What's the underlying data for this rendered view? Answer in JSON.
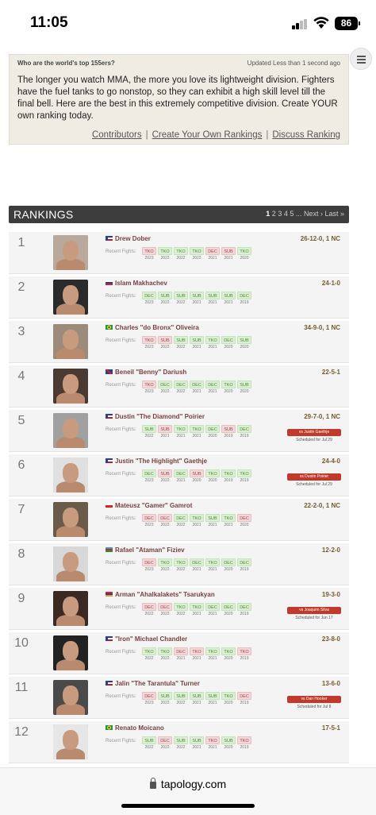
{
  "status_bar": {
    "time": "11:05",
    "battery": "86"
  },
  "intro": {
    "question": "Who are the world's top 155ers?",
    "updated": "Updated Less than 1 second ago",
    "text": "The longer you watch MMA, the more you love its lightweight division. Fighters have the fuel tanks to go nonstop, so they can exhibit a high skill level till the final bell. Here are the best in this extremely competitive division. Create YOUR own ranking today.",
    "links": [
      "Contributors",
      "Create Your Own Rankings",
      "Discuss Ranking"
    ]
  },
  "rankings": {
    "title": "RANKINGS",
    "pages": [
      "1",
      "2",
      "3",
      "4",
      "5"
    ],
    "pager_ellipsis": "...",
    "next": "Next ›",
    "last": "Last »"
  },
  "recent_label": "Recent Fights:",
  "colors": {
    "win": "#4a8a3a",
    "loss": "#a44",
    "accent": "#c0392b"
  },
  "fighters": [
    {
      "rank": "1",
      "flag": "us-flag",
      "name": "Drew Dober",
      "record": "26-12-0, 1 NC",
      "fights": [
        [
          "TKO",
          "L",
          "2023"
        ],
        [
          "TKO",
          "W",
          "2022"
        ],
        [
          "TKO",
          "W",
          "2022"
        ],
        [
          "TKO",
          "W",
          "2022"
        ],
        [
          "DEC",
          "L",
          "2021"
        ],
        [
          "SUB",
          "L",
          "2021"
        ],
        [
          "TKO",
          "W",
          "2020"
        ]
      ]
    },
    {
      "rank": "2",
      "flag": "ru-flag",
      "name": "Islam Makhachev",
      "record": "24-1-0",
      "fights": [
        [
          "DEC",
          "W",
          "2023"
        ],
        [
          "SUB",
          "W",
          "2022"
        ],
        [
          "SUB",
          "W",
          "2022"
        ],
        [
          "SUB",
          "W",
          "2021"
        ],
        [
          "SUB",
          "W",
          "2021"
        ],
        [
          "SUB",
          "W",
          "2021"
        ],
        [
          "DEC",
          "W",
          "2019"
        ]
      ]
    },
    {
      "rank": "3",
      "flag": "br-flag",
      "name": "Charles \"do Bronx\" Oliveira",
      "record": "34-9-0, 1 NC",
      "fights": [
        [
          "TKO",
          "L",
          "2023"
        ],
        [
          "SUB",
          "L",
          "2022"
        ],
        [
          "SUB",
          "W",
          "2022"
        ],
        [
          "SUB",
          "W",
          "2021"
        ],
        [
          "TKO",
          "W",
          "2021"
        ],
        [
          "DEC",
          "W",
          "2020"
        ],
        [
          "SUB",
          "W",
          "2020"
        ]
      ]
    },
    {
      "rank": "4",
      "flag": "gb-flag",
      "name": "Beneil \"Benny\" Dariush",
      "record": "22-5-1",
      "fights": [
        [
          "TKO",
          "L",
          "2023"
        ],
        [
          "DEC",
          "W",
          "2022"
        ],
        [
          "DEC",
          "W",
          "2022"
        ],
        [
          "DEC",
          "W",
          "2021"
        ],
        [
          "DEC",
          "W",
          "2021"
        ],
        [
          "TKO",
          "W",
          "2020"
        ],
        [
          "SUB",
          "W",
          "2020"
        ]
      ]
    },
    {
      "rank": "5",
      "flag": "us-flag",
      "name": "Dustin \"The Diamond\" Poirier",
      "record": "29-7-0, 1 NC",
      "fights": [
        [
          "SUB",
          "W",
          "2022"
        ],
        [
          "SUB",
          "L",
          "2021"
        ],
        [
          "TKO",
          "W",
          "2021"
        ],
        [
          "TKO",
          "W",
          "2021"
        ],
        [
          "DEC",
          "W",
          "2020"
        ],
        [
          "SUB",
          "L",
          "2019"
        ],
        [
          "DEC",
          "W",
          "2019"
        ]
      ],
      "next": {
        "label": "vs Justin Gaethje",
        "scheduled": "Scheduled for Jul 29"
      }
    },
    {
      "rank": "6",
      "flag": "us-flag",
      "name": "Justin \"The Highlight\" Gaethje",
      "record": "24-4-0",
      "fights": [
        [
          "DEC",
          "W",
          "2023"
        ],
        [
          "SUB",
          "L",
          "2022"
        ],
        [
          "DEC",
          "W",
          "2021"
        ],
        [
          "SUB",
          "L",
          "2020"
        ],
        [
          "TKO",
          "W",
          "2020"
        ],
        [
          "TKO",
          "W",
          "2019"
        ],
        [
          "TKO",
          "W",
          "2019"
        ]
      ],
      "next": {
        "label": "vs Dustin Poirier",
        "scheduled": "Scheduled for Jul 29"
      }
    },
    {
      "rank": "7",
      "flag": "pl-flag",
      "name": "Mateusz \"Gamer\" Gamrot",
      "record": "22-2-0, 1 NC",
      "fights": [
        [
          "DEC",
          "L",
          "2023"
        ],
        [
          "DEC",
          "L",
          "2022"
        ],
        [
          "DEC",
          "W",
          "2022"
        ],
        [
          "TKO",
          "W",
          "2021"
        ],
        [
          "SUB",
          "W",
          "2021"
        ],
        [
          "TKO",
          "W",
          "2021"
        ],
        [
          "DEC",
          "L",
          "2020"
        ]
      ]
    },
    {
      "rank": "8",
      "flag": "az-flag",
      "name": "Rafael \"Ataman\" Fiziev",
      "record": "12-2-0",
      "fights": [
        [
          "DEC",
          "L",
          "2023"
        ],
        [
          "TKO",
          "W",
          "2022"
        ],
        [
          "TKO",
          "W",
          "2022"
        ],
        [
          "DEC",
          "W",
          "2021"
        ],
        [
          "TKO",
          "W",
          "2021"
        ],
        [
          "DEC",
          "W",
          "2020"
        ],
        [
          "DEC",
          "W",
          "2019"
        ]
      ]
    },
    {
      "rank": "9",
      "flag": "am-flag",
      "name": "Arman \"Ahalkalakets\" Tsarukyan",
      "record": "19-3-0",
      "fights": [
        [
          "DEC",
          "L",
          "2022"
        ],
        [
          "DEC",
          "L",
          "2022"
        ],
        [
          "TKO",
          "W",
          "2022"
        ],
        [
          "TKO",
          "W",
          "2021"
        ],
        [
          "DEC",
          "W",
          "2021"
        ],
        [
          "DEC",
          "W",
          "2020"
        ],
        [
          "DEC",
          "W",
          "2019"
        ]
      ],
      "next": {
        "label": "vs Joaquim Silva",
        "scheduled": "Scheduled for Jun 17"
      }
    },
    {
      "rank": "10",
      "flag": "us-flag",
      "name": "\"Iron\" Michael Chandler",
      "record": "23-8-0",
      "fights": [
        [
          "TKO",
          "W",
          "2022"
        ],
        [
          "TKO",
          "W",
          "2022"
        ],
        [
          "DEC",
          "L",
          "2021"
        ],
        [
          "TKO",
          "L",
          "2021"
        ],
        [
          "TKO",
          "W",
          "2021"
        ],
        [
          "TKO",
          "W",
          "2020"
        ],
        [
          "TKO",
          "L",
          "2019"
        ]
      ]
    },
    {
      "rank": "11",
      "flag": "us-flag",
      "name": "Jalin \"The Tarantula\" Turner",
      "record": "13-6-0",
      "fights": [
        [
          "DEC",
          "L",
          "2023"
        ],
        [
          "SUB",
          "W",
          "2022"
        ],
        [
          "SUB",
          "W",
          "2022"
        ],
        [
          "SUB",
          "W",
          "2021"
        ],
        [
          "SUB",
          "W",
          "2021"
        ],
        [
          "TKO",
          "W",
          "2020"
        ],
        [
          "DEC",
          "L",
          "2019"
        ]
      ],
      "next": {
        "label": "vs Dan Hooker",
        "scheduled": "Scheduled for Jul 8"
      }
    },
    {
      "rank": "12",
      "flag": "br-flag",
      "name": "Renato Moicano",
      "record": "17-5-1",
      "fights": [
        [
          "SUB",
          "W",
          "2022"
        ],
        [
          "DEC",
          "L",
          "2022"
        ],
        [
          "SUB",
          "W",
          "2022"
        ],
        [
          "SUB",
          "W",
          "2021"
        ],
        [
          "TKO",
          "L",
          "2021"
        ],
        [
          "SUB",
          "W",
          "2020"
        ],
        [
          "TKO",
          "L",
          "2019"
        ]
      ]
    }
  ],
  "browser": {
    "url": "tapology.com"
  }
}
